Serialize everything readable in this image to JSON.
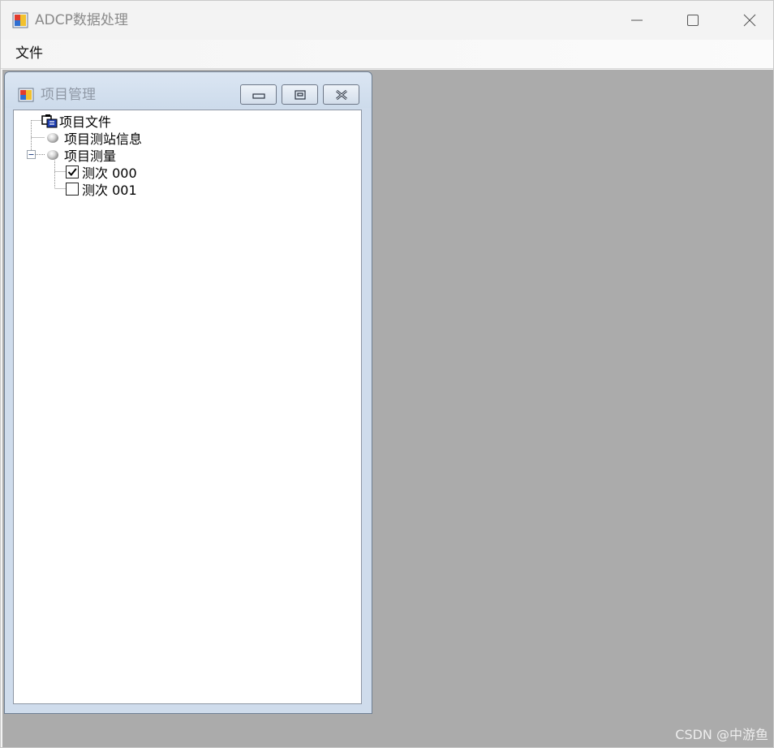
{
  "window": {
    "title": "ADCP数据处理",
    "icon": "app-icon"
  },
  "menu": {
    "file_label": "文件"
  },
  "child_window": {
    "title": "项目管理",
    "icon": "app-icon"
  },
  "tree": {
    "nodes": [
      {
        "label": "项目文件",
        "icon": "project-file-icon"
      },
      {
        "label": "项目测站信息",
        "icon": "sphere-icon"
      },
      {
        "label": "项目测量",
        "icon": "sphere-icon",
        "expanded": true
      },
      {
        "label": "测次 000",
        "checked": true
      },
      {
        "label": "测次 001",
        "checked": false
      }
    ]
  },
  "watermark": "CSDN @中游鱼",
  "colors": {
    "mdi_background": "#ababab",
    "child_frame": "#cfdcec",
    "title_text": "#8a8a8a"
  }
}
